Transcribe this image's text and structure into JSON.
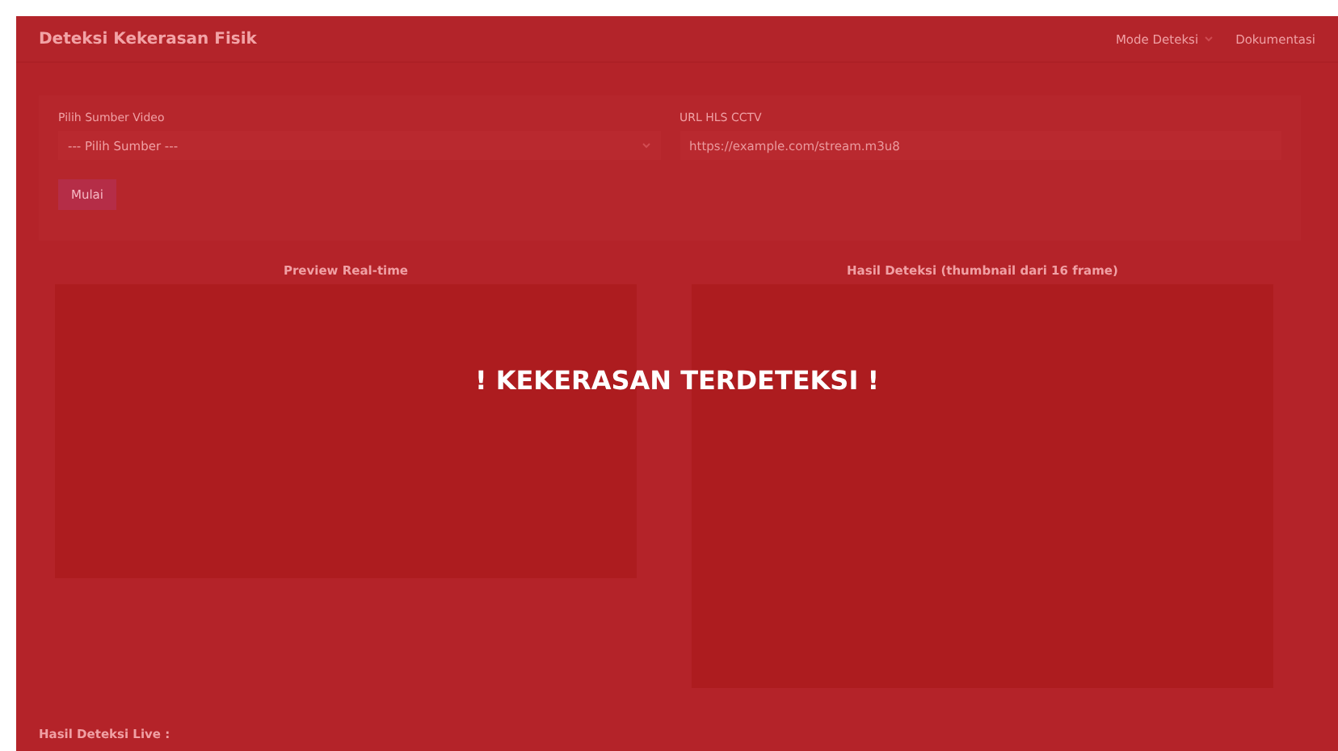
{
  "navbar": {
    "brand": "Deteksi Kekerasan Fisik",
    "links": [
      {
        "label": "Mode Deteksi",
        "kind": "dropdown"
      },
      {
        "label": "Dokumentasi",
        "kind": "link"
      }
    ]
  },
  "source_form": {
    "source_label": "Pilih Sumber Video",
    "source_value": "--- Pilih Sumber ---",
    "url_label": "URL HLS CCTV",
    "url_placeholder": "https://example.com/stream.m3u8",
    "start_button": "Mulai"
  },
  "preview": {
    "title": "Preview Real-time"
  },
  "results": {
    "title": "Hasil Deteksi (thumbnail dari 16 frame)"
  },
  "alert": {
    "text": "! KEKERASAN TERDETEKSI !"
  },
  "live_results": {
    "title": "Hasil Deteksi Live :"
  }
}
